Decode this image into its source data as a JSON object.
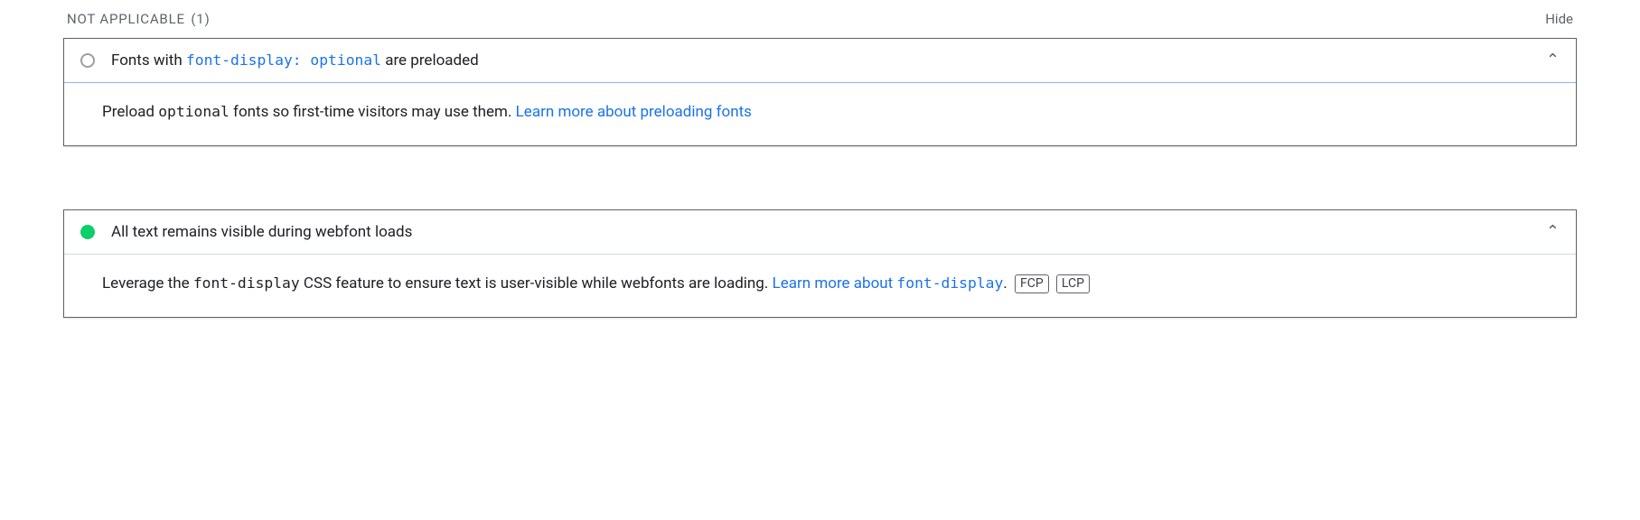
{
  "section": {
    "title": "Not Applicable",
    "count": "(1)",
    "hide_label": "Hide"
  },
  "audits": [
    {
      "status": "na",
      "title_pre": "Fonts with ",
      "title_code": "font-display: optional",
      "title_post": " are preloaded",
      "desc_pre": "Preload ",
      "desc_code": "optional",
      "desc_mid": " fonts so first-time visitors may use them. ",
      "link_text": "Learn more about preloading fonts",
      "desc_post": "",
      "tags": []
    },
    {
      "status": "pass",
      "title_pre": "All text remains visible during webfont loads",
      "title_code": "",
      "title_post": "",
      "desc_pre": "Leverage the ",
      "desc_code": "font-display",
      "desc_mid": " CSS feature to ensure text is user-visible while webfonts are loading. ",
      "link_text": "Learn more about ",
      "link_code": "font-display",
      "desc_post": ".",
      "tags": [
        "FCP",
        "LCP"
      ]
    }
  ]
}
